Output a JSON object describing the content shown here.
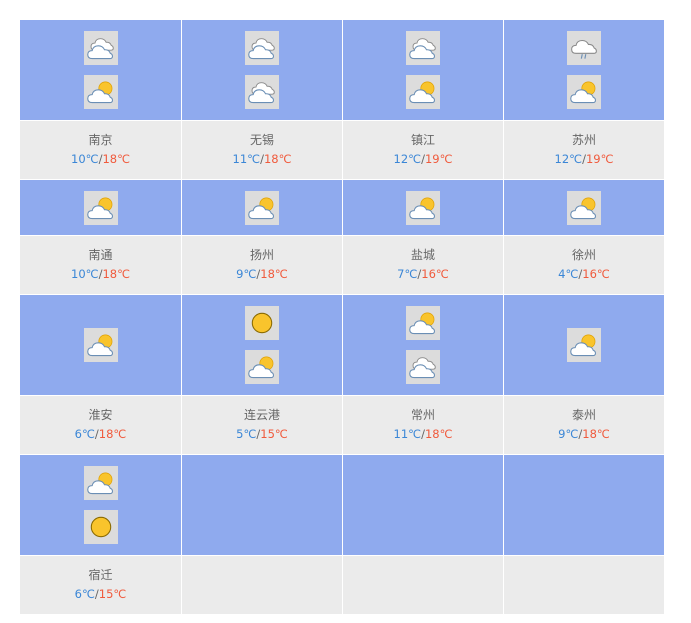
{
  "cities": [
    {
      "name": "南京",
      "low": "10℃",
      "high": "18℃",
      "icons": [
        "cloudy-icon",
        "partly-cloudy-icon"
      ]
    },
    {
      "name": "无锡",
      "low": "11℃",
      "high": "18℃",
      "icons": [
        "cloudy-icon",
        "cloudy-icon"
      ]
    },
    {
      "name": "镇江",
      "low": "12℃",
      "high": "19℃",
      "icons": [
        "cloudy-icon",
        "partly-cloudy-icon"
      ]
    },
    {
      "name": "苏州",
      "low": "12℃",
      "high": "19℃",
      "icons": [
        "drizzle-icon",
        "partly-cloudy-icon"
      ]
    },
    {
      "name": "南通",
      "low": "10℃",
      "high": "18℃",
      "icons": [
        "partly-cloudy-icon"
      ]
    },
    {
      "name": "扬州",
      "low": "9℃",
      "high": "18℃",
      "icons": [
        "partly-cloudy-icon"
      ]
    },
    {
      "name": "盐城",
      "low": "7℃",
      "high": "16℃",
      "icons": [
        "partly-cloudy-icon"
      ]
    },
    {
      "name": "徐州",
      "low": "4℃",
      "high": "16℃",
      "icons": [
        "partly-cloudy-icon"
      ]
    },
    {
      "name": "淮安",
      "low": "6℃",
      "high": "18℃",
      "icons": [
        "partly-cloudy-icon"
      ]
    },
    {
      "name": "连云港",
      "low": "5℃",
      "high": "15℃",
      "icons": [
        "sunny-icon",
        "partly-cloudy-icon"
      ]
    },
    {
      "name": "常州",
      "low": "11℃",
      "high": "18℃",
      "icons": [
        "partly-cloudy-icon",
        "cloudy-icon"
      ]
    },
    {
      "name": "泰州",
      "low": "9℃",
      "high": "18℃",
      "icons": [
        "partly-cloudy-icon"
      ]
    },
    {
      "name": "宿迁",
      "low": "6℃",
      "high": "15℃",
      "icons": [
        "partly-cloudy-icon",
        "sunny-icon"
      ]
    }
  ],
  "separator": "/",
  "colors": {
    "icon_row_bg": "#8faaee",
    "text_row_bg": "#ebebeb",
    "low_temp": "#3a86d6",
    "high_temp": "#f05a3c"
  }
}
